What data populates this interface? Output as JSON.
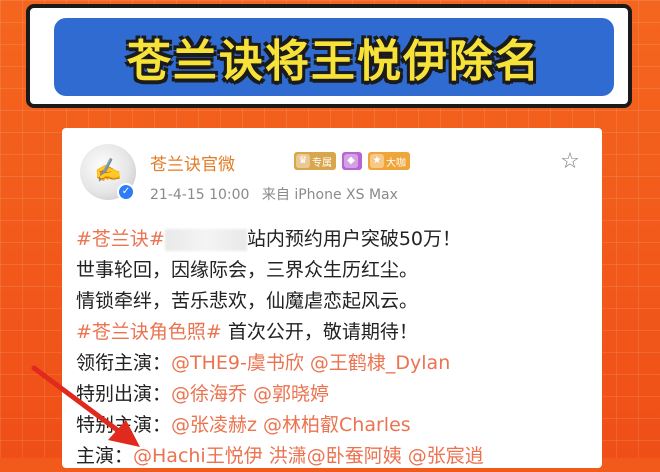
{
  "banner": {
    "title": "苍兰诀将王悦伊除名"
  },
  "post": {
    "account_name": "苍兰诀官微",
    "badges": [
      {
        "label": "专属",
        "icon": "crown-icon",
        "color": "#d9a64e"
      },
      {
        "label": "",
        "icon": "gem-icon",
        "color": "#b864d2"
      },
      {
        "label": "大咖",
        "icon": "star-badge-icon",
        "color": "#f0a53a"
      }
    ],
    "timestamp": "21-4-15 10:00",
    "source": "来自 iPhone XS Max",
    "lines": [
      {
        "pre": "#苍兰诀#",
        "blur": true,
        "text": "站内预约用户突破50万！"
      },
      {
        "text": "世事轮回，因缘际会，三界众生历红尘。"
      },
      {
        "text": "情锁牵绊，苦乐悲欢，仙魔虐恋起风云。"
      },
      {
        "pre": "#苍兰诀角色照#",
        "text": " 首次公开，敬请期待！"
      },
      {
        "label": "领衔主演：",
        "mentions": "@THE9-虞书欣 @王鹤棣_Dylan"
      },
      {
        "label": "特别出演：",
        "mentions": "@徐海乔 @郭晓婷"
      },
      {
        "label": "特别主演：",
        "mentions": "@张凌赫z @林柏叡Charles"
      },
      {
        "label": "主演：",
        "mentions": "@Hachi王悦伊 洪潇@卧蚕阿姨 @张宸逍"
      }
    ]
  },
  "colors": {
    "background": "#f25a1c",
    "banner_fill": "#2f6bd0",
    "banner_text": "#f7e23a",
    "link": "#eb7350",
    "arrow": "#e02a1d"
  }
}
